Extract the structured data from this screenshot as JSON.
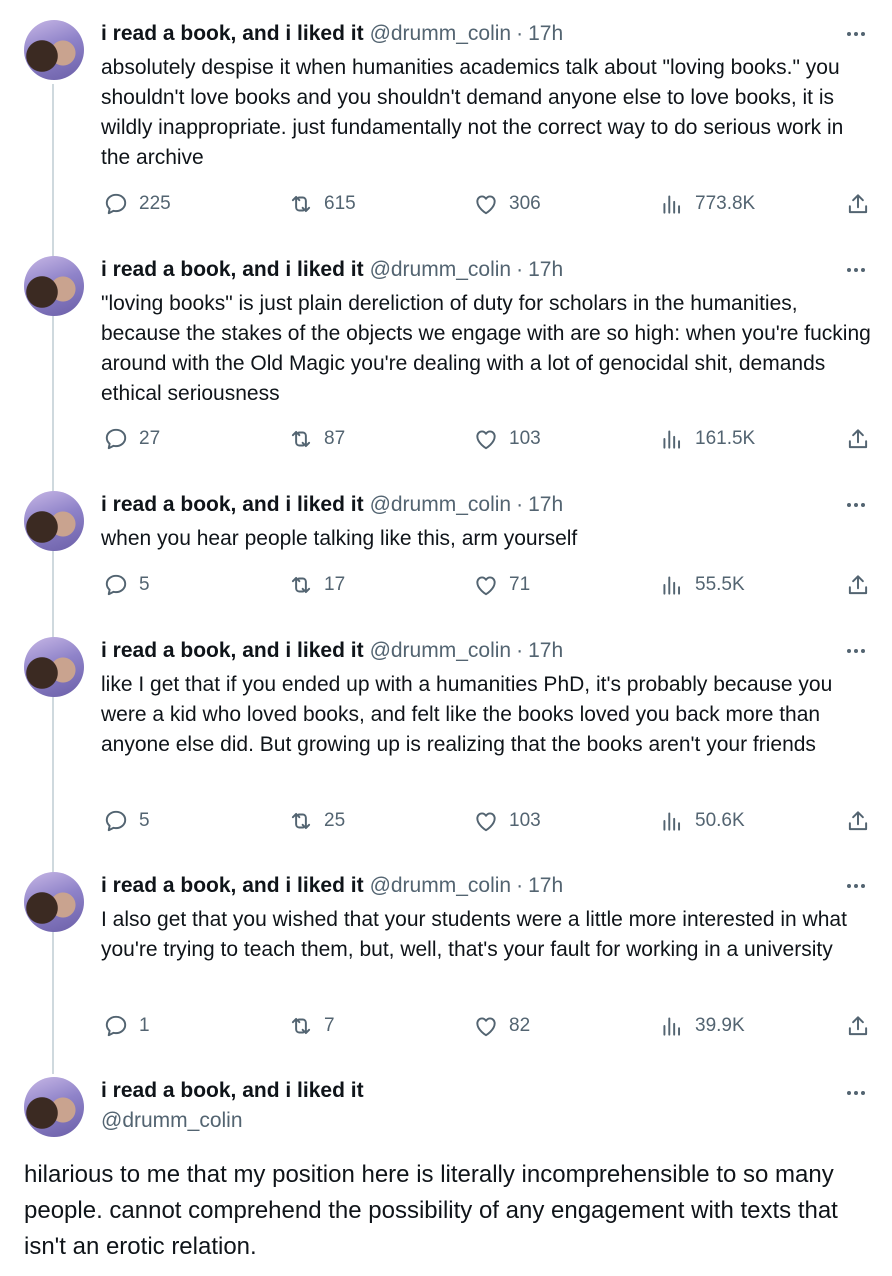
{
  "author": {
    "name": "i read a book, and i liked it",
    "handle": "@drumm_colin",
    "separator": "·"
  },
  "icons": {
    "reply": "reply-icon",
    "retweet": "retweet-icon",
    "like": "heart-icon",
    "views": "views-icon",
    "share": "share-icon",
    "more": "more-icon"
  },
  "colors": {
    "text": "#0f1419",
    "muted": "#536471",
    "thread_line": "#cfd9de"
  },
  "tweets": [
    {
      "time": "17h",
      "text": "absolutely despise it when humanities academics talk about \"loving books.\" you shouldn't love books and you shouldn't demand anyone else to love books, it is wildly inappropriate. just fundamentally not the correct way to do serious work in the archive",
      "replies": "225",
      "retweets": "615",
      "likes": "306",
      "views": "773.8K"
    },
    {
      "time": "17h",
      "text": "\"loving books\" is just plain dereliction of duty for scholars in the humanities, because the stakes of the objects we engage with are so high: when you're fucking around with the Old Magic you're dealing with a lot of genocidal shit, demands ethical seriousness",
      "replies": "27",
      "retweets": "87",
      "likes": "103",
      "views": "161.5K"
    },
    {
      "time": "17h",
      "text": "when you hear people talking like this, arm yourself",
      "replies": "5",
      "retweets": "17",
      "likes": "71",
      "views": "55.5K"
    },
    {
      "time": "17h",
      "text": "like I get that if you ended up with a humanities PhD, it's probably because you were a kid who loved books, and felt like the books loved you back more than anyone else did. But growing up is realizing that the books aren't your friends",
      "replies": "5",
      "retweets": "25",
      "likes": "103",
      "views": "50.6K"
    },
    {
      "time": "17h",
      "text": "I also get that you wished that your students were a little more interested in what you're trying to teach them, but, well, that's your fault for working in a university",
      "replies": "1",
      "retweets": "7",
      "likes": "82",
      "views": "39.9K"
    }
  ],
  "final_tweet": {
    "text": "hilarious to me that my position here is literally incomprehensible to so many people. cannot comprehend the possibility of any engagement with texts that isn't an erotic relation."
  }
}
